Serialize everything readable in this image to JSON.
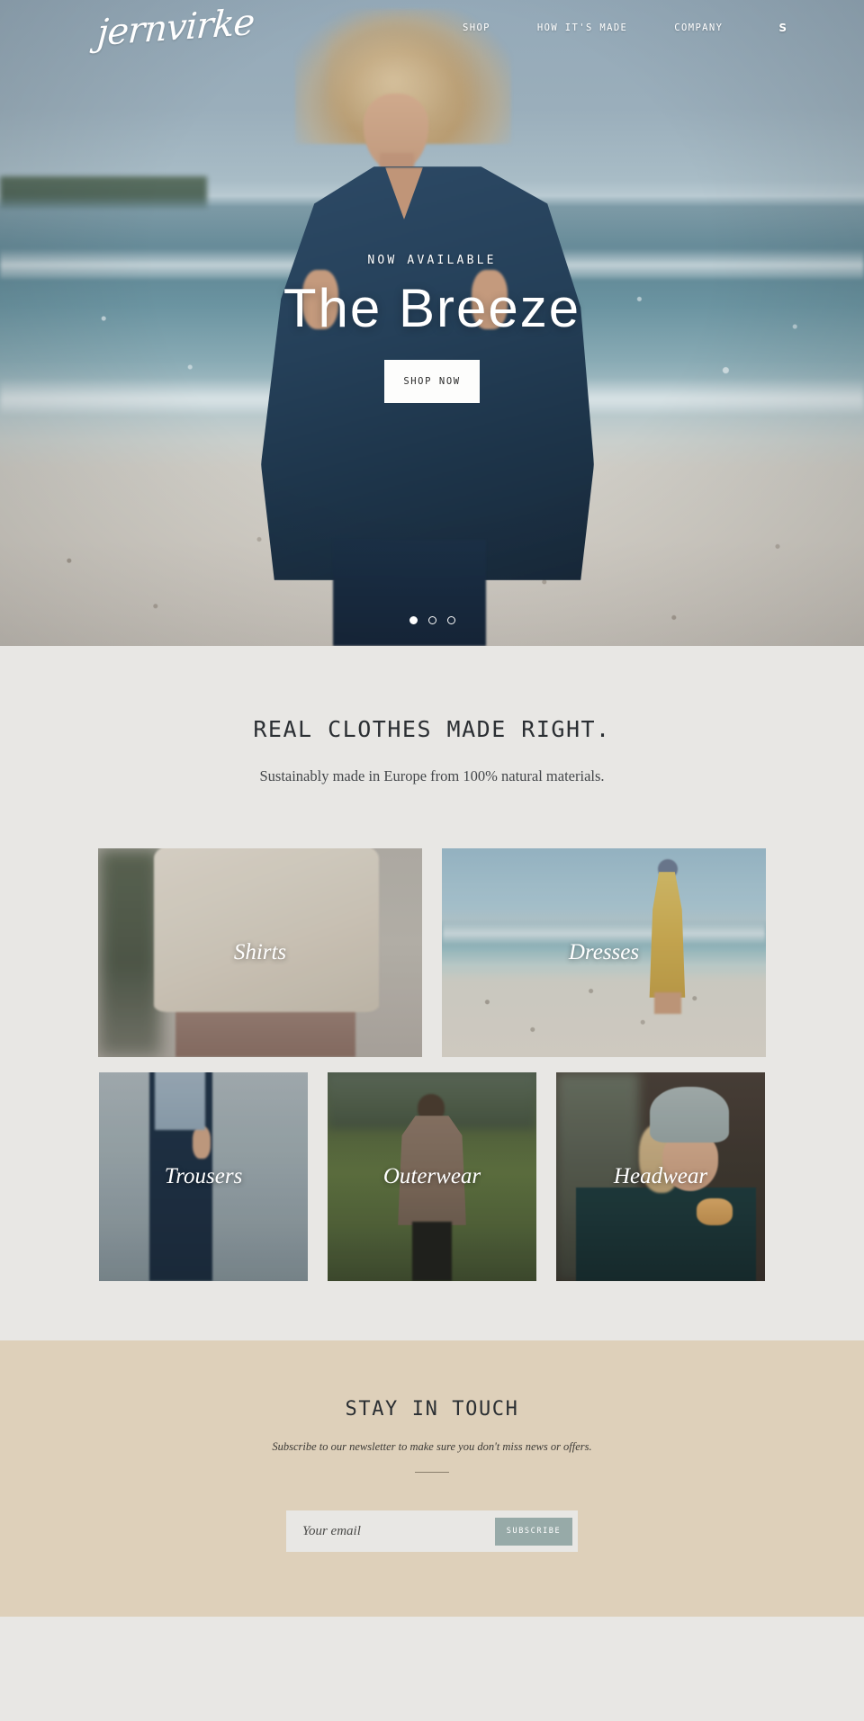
{
  "brand": {
    "logo_text": "jernvirke"
  },
  "nav": {
    "links": [
      {
        "label": "SHOP"
      },
      {
        "label": "HOW IT'S MADE"
      },
      {
        "label": "COMPANY"
      }
    ],
    "cart_glyph": "S"
  },
  "hero": {
    "eyebrow": "NOW AVAILABLE",
    "title": "The Breeze",
    "cta_label": "SHOP NOW",
    "slides": 3,
    "active_slide": 1
  },
  "intro": {
    "heading": "REAL CLOTHES MADE RIGHT.",
    "subheading": "Sustainably made in Europe from 100% natural materials."
  },
  "categories": {
    "row1": [
      {
        "label": "Shirts"
      },
      {
        "label": "Dresses"
      }
    ],
    "row2": [
      {
        "label": "Trousers"
      },
      {
        "label": "Outerwear"
      },
      {
        "label": "Headwear"
      }
    ]
  },
  "newsletter": {
    "heading": "STAY IN TOUCH",
    "subheading": "Subscribe to our newsletter to make sure you don't miss news or offers.",
    "email_placeholder": "Your email",
    "email_value": "",
    "submit_label": "SUBSCRIBE"
  },
  "colors": {
    "page_bg": "#e8e7e4",
    "newsletter_bg": "#ded0ba",
    "accent_button": "#97aaa8",
    "text_dark": "#2b2f33",
    "on_dark": "#ffffff"
  }
}
